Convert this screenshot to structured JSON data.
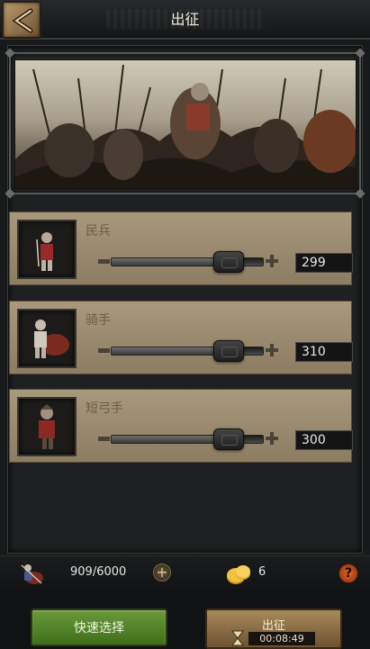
{
  "header": {
    "title": "出征"
  },
  "units": [
    {
      "name": "民兵",
      "count": "299",
      "level": 0.84
    },
    {
      "name": "骑手",
      "count": "310",
      "level": 0.84
    },
    {
      "name": "短弓手",
      "count": "300",
      "level": 0.84
    }
  ],
  "status": {
    "capacity": "909/6000",
    "gold": "6"
  },
  "actions": {
    "quick_select": "快速选择",
    "march": "出征",
    "march_time": "00:08:49"
  },
  "colors": {
    "card_bg": "#a8987c",
    "quick_select_green": "#5a8a2e",
    "march_tan": "#9a7a4a",
    "help_orange": "#d45a1a"
  }
}
